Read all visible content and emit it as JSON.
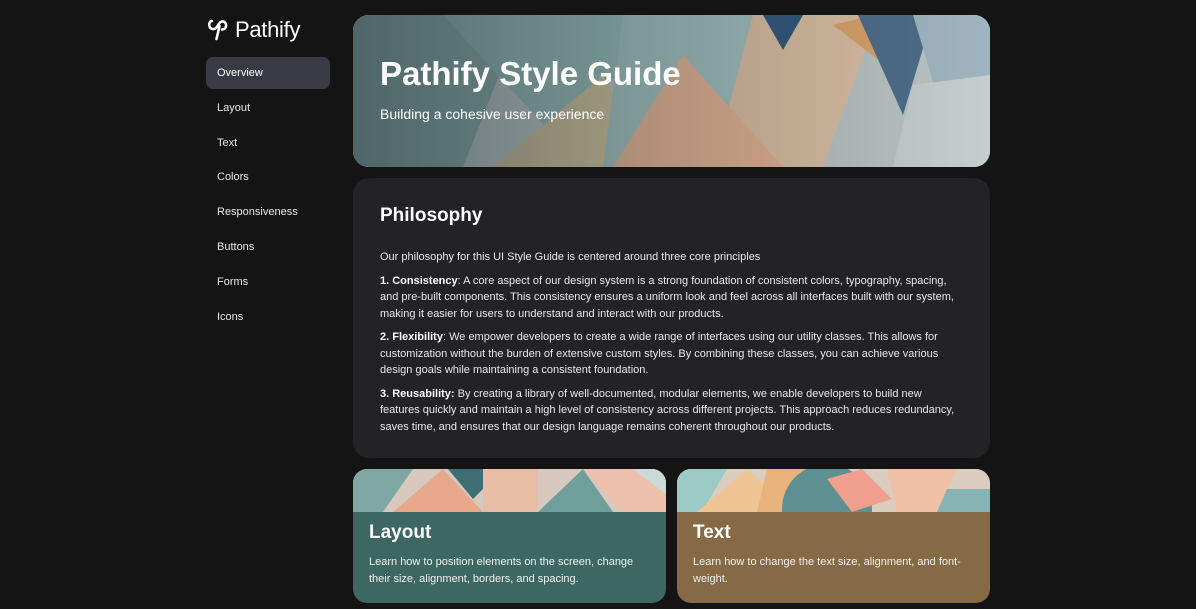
{
  "brand": {
    "name": "Pathify",
    "logo_icon": "pathify-logo-icon"
  },
  "sidebar": {
    "items": [
      {
        "label": "Overview",
        "active": true
      },
      {
        "label": "Layout",
        "active": false
      },
      {
        "label": "Text",
        "active": false
      },
      {
        "label": "Colors",
        "active": false
      },
      {
        "label": "Responsiveness",
        "active": false
      },
      {
        "label": "Buttons",
        "active": false
      },
      {
        "label": "Forms",
        "active": false
      },
      {
        "label": "Icons",
        "active": false
      }
    ]
  },
  "hero": {
    "title": "Pathify Style Guide",
    "subtitle": "Building a cohesive user experience"
  },
  "philosophy": {
    "heading": "Philosophy",
    "intro": "Our philosophy for this UI Style Guide is centered around three core principles",
    "principles": [
      {
        "title": "1. Consistency",
        "text": ": A core aspect of our design system is a strong foundation of consistent colors, typography, spacing, and pre-built components. This consistency ensures a uniform look and feel across all interfaces built with our system, making it easier for users to understand and interact with our products."
      },
      {
        "title": "2. Flexibility",
        "text": ": We empower developers to create a wide range of interfaces using our utility classes. This allows for customization without the burden of extensive custom styles. By combining these classes, you can achieve various design goals while maintaining a consistent foundation."
      },
      {
        "title": "3. Reusability:",
        "text": " By creating a library of well-documented, modular elements, we enable developers to build new features quickly and maintain a high level of consistency across different projects. This approach reduces redundancy, saves time, and ensures that our design language remains coherent throughout our products."
      }
    ]
  },
  "cards": [
    {
      "title": "Layout",
      "description": "Learn how to position elements on the screen, change their size, alignment, borders, and spacing.",
      "color": "#3c6861"
    },
    {
      "title": "Text",
      "description": "Learn how to change the text size, alignment, and font-weight.",
      "color": "#856a45"
    }
  ],
  "colors": {
    "background": "#141414",
    "sidebar_active": "#3a3a44",
    "panel": "#232227"
  }
}
